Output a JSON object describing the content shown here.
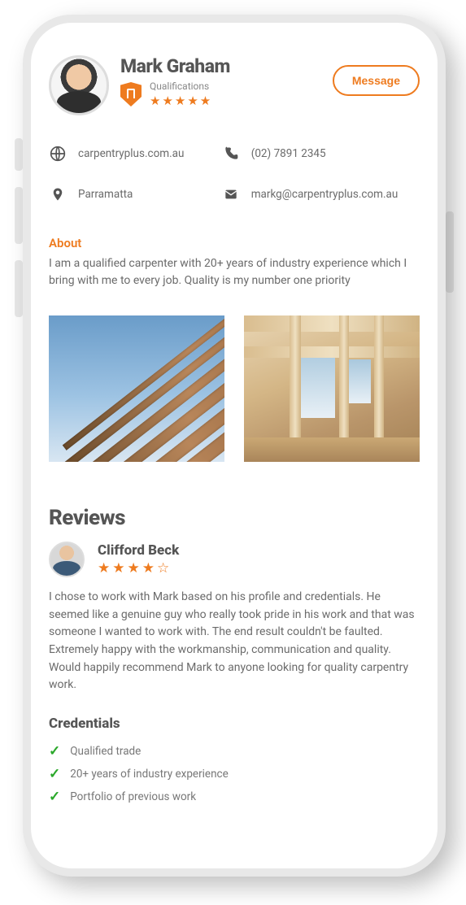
{
  "profile": {
    "name": "Mark Graham",
    "qualifications_label": "Qualifications",
    "rating_stars": 5
  },
  "actions": {
    "message_label": "Message"
  },
  "contact": {
    "website": "carpentryplus.com.au",
    "phone": "(02) 7891 2345",
    "location": "Parramatta",
    "email": "markg@carpentryplus.com.au"
  },
  "about": {
    "heading": "About",
    "text": "I am a qualified carpenter with 20+ years of industry experience which I bring with me to every job. Quality is my number one priority"
  },
  "reviews": {
    "heading": "Reviews",
    "items": [
      {
        "name": "Clifford Beck",
        "rating_stars": 4,
        "text": "I chose to work with Mark based on his profile and credentials. He seemed like a genuine guy who really took pride in his work and that was someone I wanted to work with. The end result couldn't be faulted. Extremely happy with the workmanship, communication and quality. Would happily recommend Mark to anyone looking for quality carpentry work."
      }
    ]
  },
  "credentials": {
    "heading": "Credentials",
    "items": [
      "Qualified trade",
      "20+ years of industry experience",
      "Portfolio of previous work"
    ]
  },
  "colors": {
    "accent": "#ee7b1f"
  }
}
